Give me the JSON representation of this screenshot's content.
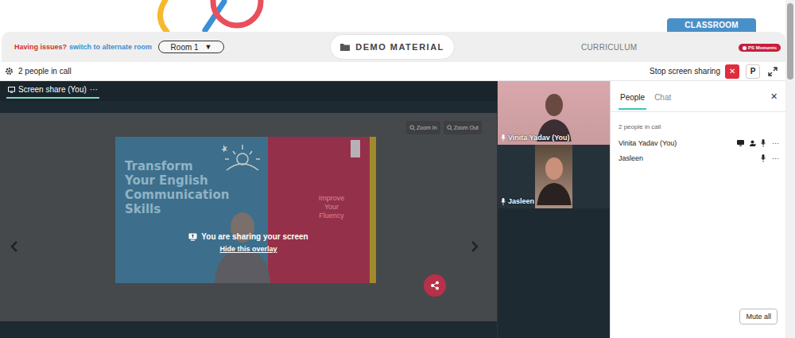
{
  "header": {
    "tab": "CLASSROOM"
  },
  "toolbar": {
    "issues_prefix": "Having issues?",
    "issues_link": "switch to alternate room",
    "room": "Room 1",
    "room_arrow": "▼",
    "demo": "DEMO MATERIAL",
    "curriculum": "CURRICULUM",
    "badge": "PS Moments"
  },
  "callbar": {
    "count": "2 people in call",
    "stop": "Stop screen sharing",
    "stop_icon": "✕",
    "p": "P"
  },
  "share": {
    "tab": "Screen share (You)",
    "tab_more": "···",
    "zoom_in": "Zoom In",
    "zoom_out": "Zoom Out",
    "overlay": "You are sharing your screen",
    "hide": "Hide this overlay"
  },
  "slide": {
    "title": [
      "Transform",
      "Your English",
      "Communication",
      "Skills"
    ],
    "subtitle": "Improve Your Fluency"
  },
  "tiles": [
    {
      "name": "Vinita Yadav (You)"
    },
    {
      "name": "Jasleen"
    }
  ],
  "panel": {
    "tabs": [
      {
        "label": "People",
        "selected": true
      },
      {
        "label": "Chat",
        "selected": false
      }
    ],
    "close": "✕",
    "count": "2 people in call",
    "people": [
      {
        "name": "Vinita Yadav (You)",
        "sharing": true,
        "more": "···"
      },
      {
        "name": "Jasleen",
        "sharing": false,
        "more": "···"
      }
    ],
    "mute_all": "Mute all"
  }
}
